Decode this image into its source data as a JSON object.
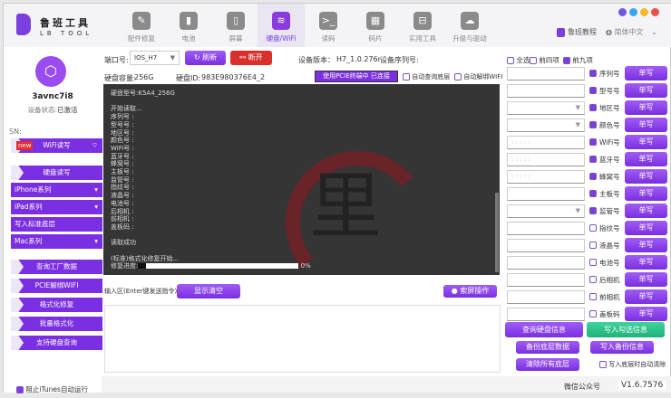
{
  "app": {
    "name": "鲁班工具",
    "sub": "LB TOOL",
    "tutorial": "鲁班教程",
    "language": "简体中文"
  },
  "nav": [
    {
      "label": "配件修复",
      "icon": "wrench-icon",
      "g": "✎"
    },
    {
      "label": "电池",
      "icon": "battery-icon",
      "g": "▮"
    },
    {
      "label": "屏幕",
      "icon": "screen-icon",
      "g": "▯"
    },
    {
      "label": "硬盘/WiFi",
      "icon": "wifi-disk-icon",
      "g": "≋"
    },
    {
      "label": "读码",
      "icon": "terminal-icon",
      "g": ">_"
    },
    {
      "label": "码片",
      "icon": "chip-icon",
      "g": "▦"
    },
    {
      "label": "实用工具",
      "icon": "toolbox-icon",
      "g": "⊟"
    },
    {
      "label": "升级与驱动",
      "icon": "cloud-upload-icon",
      "g": "☁"
    }
  ],
  "device": {
    "name": "3avnc7i8",
    "status_label": "设备状态:",
    "status": "已激活",
    "sn_label": "SN:"
  },
  "sidebar": {
    "new_badge": "new",
    "items": [
      "WiFi读写",
      "硬盘读写",
      "iPhone系列",
      "iPad系列",
      "写入标准底层",
      "Mac系列",
      "查询工厂数据",
      "PCIE解绑WIFI",
      "格式化修复",
      "批量格式化",
      "支持硬盘查询"
    ],
    "itunes": "阻止iTunes自动运行"
  },
  "top": {
    "port_label": "端口号:",
    "port": "IOS_H7",
    "refresh": "刷新",
    "disconnect": "断开",
    "ver_label": "设备版本：",
    "ver": "H7_1.0.276r",
    "serial_label": "设备序列号:",
    "cap_label": "硬盘容量:",
    "cap": "256G",
    "id_label": "硬盘ID:",
    "id": "983E980376E4_2",
    "pcie": "使用PCIE终端中 已连接",
    "auto_query": "自动查询底层",
    "auto_unbind": "自动解绑WIFI"
  },
  "console": {
    "lines": [
      "硬盘型号:K5A4_256G",
      "",
      "开始读取...",
      "序列号 :",
      "型号号 :",
      "地区号 :",
      "颜色号 :",
      "WiFi号 :",
      "蓝牙号 :",
      "蜂窝号 :",
      "主板号 :",
      "监管号 :",
      "指纹号 :",
      "液晶号 :",
      "电池号 :",
      "后相机 :",
      "前相机 :",
      "盖板码 :",
      "",
      "读取成功",
      "",
      "(标准)格式化修复开始..."
    ],
    "progress_label": "修复进度:",
    "progress": 5,
    "progress_text": "0%"
  },
  "input": {
    "label": "输入区(Enter键发送指令)",
    "clear": "显示清空",
    "screen": "索屏操作"
  },
  "right": {
    "select_all": "全选",
    "first4": "前四项",
    "first9": "前九项",
    "rows": [
      {
        "label": "序列号",
        "on": true,
        "type": "text",
        "ph": ""
      },
      {
        "label": "型号号",
        "on": true,
        "type": "text",
        "ph": ""
      },
      {
        "label": "地区号",
        "on": true,
        "type": "select",
        "ph": ""
      },
      {
        "label": "颜色号",
        "on": true,
        "type": "select",
        "ph": ""
      },
      {
        "label": "WiFi号",
        "on": true,
        "type": "text",
        "ph": ": : : : :"
      },
      {
        "label": "蓝牙号",
        "on": true,
        "type": "text",
        "ph": ": : : : :"
      },
      {
        "label": "蜂窝号",
        "on": true,
        "type": "text",
        "ph": ": : : : :"
      },
      {
        "label": "主板号",
        "on": true,
        "type": "text",
        "ph": ""
      },
      {
        "label": "监管号",
        "on": true,
        "type": "select",
        "ph": ""
      },
      {
        "label": "指纹号",
        "on": false,
        "type": "text",
        "ph": ""
      },
      {
        "label": "液晶号",
        "on": false,
        "type": "text",
        "ph": ""
      },
      {
        "label": "电池号",
        "on": false,
        "type": "text",
        "ph": ""
      },
      {
        "label": "后相机",
        "on": false,
        "type": "text",
        "ph": ""
      },
      {
        "label": "前相机",
        "on": false,
        "type": "text",
        "ph": ""
      },
      {
        "label": "盖板码",
        "on": false,
        "type": "text",
        "ph": ""
      }
    ],
    "write_single": "单写",
    "query": "查询硬盘信息",
    "write_checked": "写入勾选信息",
    "backup": "备份底层数据",
    "write_backup": "写入备份信息",
    "clear_all": "清除所有底层",
    "auto_clear": "写入底层时自动清除"
  },
  "footer": {
    "wechat": "微信公众号",
    "version": "V1.6.7576"
  },
  "colors": {
    "accent": "#7b2fe3",
    "green": "#2fc48f",
    "red": "#d9302c"
  }
}
